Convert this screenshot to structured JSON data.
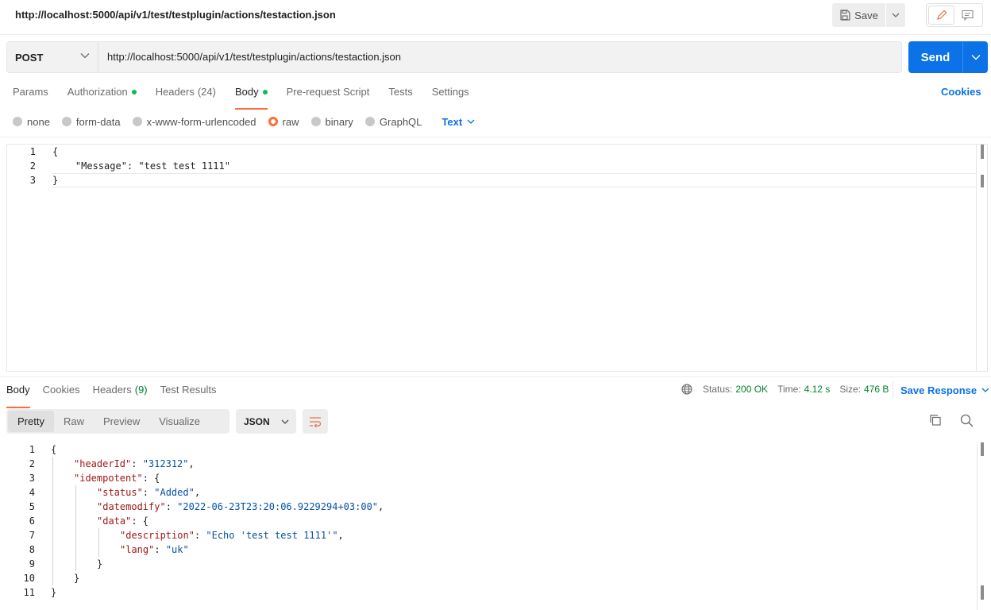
{
  "request": {
    "title": "http://localhost:5000/api/v1/test/testplugin/actions/testaction.json",
    "method": "POST",
    "url": "http://localhost:5000/api/v1/test/testplugin/actions/testaction.json",
    "save_label": "Save",
    "send_label": "Send",
    "cookies_label": "Cookies",
    "tabs": [
      {
        "label": "Params",
        "count": "",
        "dot": false
      },
      {
        "label": "Authorization",
        "count": "",
        "dot": true
      },
      {
        "label": "Headers",
        "count": "(24)",
        "dot": false
      },
      {
        "label": "Body",
        "count": "",
        "dot": true
      },
      {
        "label": "Pre-request Script",
        "count": "",
        "dot": false
      },
      {
        "label": "Tests",
        "count": "",
        "dot": false
      },
      {
        "label": "Settings",
        "count": "",
        "dot": false
      }
    ],
    "body_types": [
      "none",
      "form-data",
      "x-www-form-urlencoded",
      "raw",
      "binary",
      "GraphQL"
    ],
    "body_format": "Text",
    "body_lines": [
      "1",
      "2",
      "3"
    ],
    "body_code": [
      "{",
      "    \"Message\": \"test test 1111\"",
      "}"
    ]
  },
  "response": {
    "tabs": [
      {
        "label": "Body",
        "count": ""
      },
      {
        "label": "Cookies",
        "count": ""
      },
      {
        "label": "Headers",
        "count": "(9)"
      },
      {
        "label": "Test Results",
        "count": ""
      }
    ],
    "status_label": "Status:",
    "status_value": "200 OK",
    "time_label": "Time:",
    "time_value": "4.12 s",
    "size_label": "Size:",
    "size_value": "476 B",
    "save_response_label": "Save Response",
    "view_tabs": [
      "Pretty",
      "Raw",
      "Preview",
      "Visualize"
    ],
    "format": "JSON",
    "line_numbers": [
      "1",
      "2",
      "3",
      "4",
      "5",
      "6",
      "7",
      "8",
      "9",
      "10",
      "11"
    ],
    "json": {
      "headerId_key": "\"headerId\"",
      "headerId_val": "\"312312\"",
      "idempotent_key": "\"idempotent\"",
      "status_key": "\"status\"",
      "status_val": "\"Added\"",
      "datemodify_key": "\"datemodify\"",
      "datemodify_val": "\"2022-06-23T23:20:06.9229294+03:00\"",
      "data_key": "\"data\"",
      "description_key": "\"description\"",
      "description_val": "\"Echo 'test test 1111'\"",
      "lang_key": "\"lang\"",
      "lang_val": "\"uk\""
    }
  },
  "colors": {
    "accent": "#ff6c37",
    "send_blue": "#0b72e7",
    "status_green": "#007f31",
    "json_key": "#a31515",
    "json_string": "#0451a5"
  }
}
